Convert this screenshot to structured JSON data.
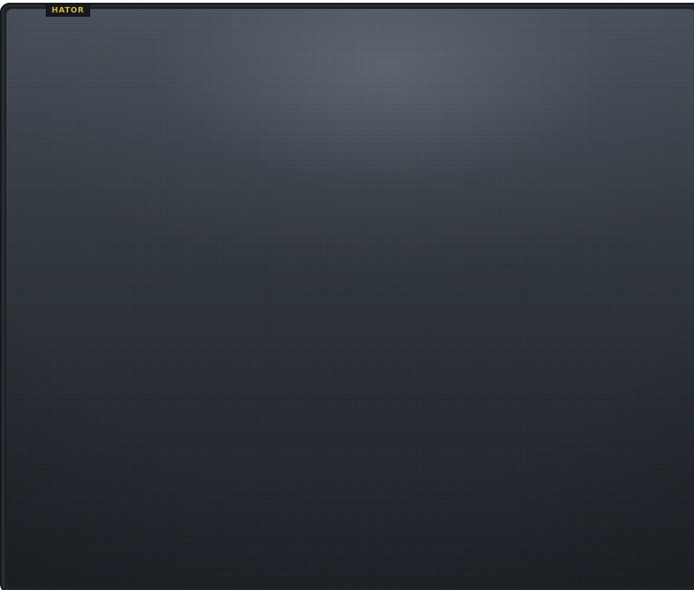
{
  "image": {
    "subject": "mousepad",
    "brand_label": "HATOR",
    "brand_label_color": "#d9b53a",
    "surface_color_top": "#4a525c",
    "surface_color_bottom": "#1f242a",
    "edge_color": "#1b1f24"
  }
}
